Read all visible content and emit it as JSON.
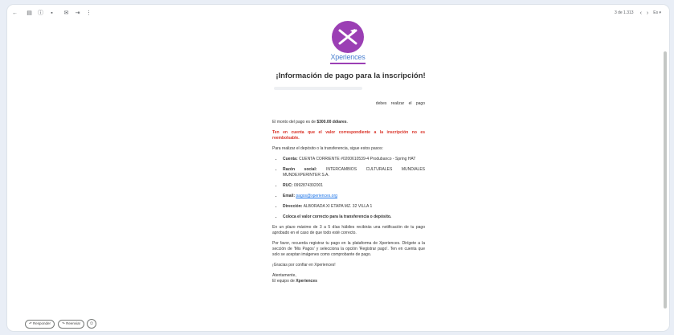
{
  "toolbar": {
    "icons": [
      "back-arrow-icon",
      "archive-icon",
      "report-spam-icon",
      "delete-icon",
      "mark-unread-icon",
      "move-to-icon",
      "more-icon"
    ],
    "count": "3 de 1.313",
    "prev": "‹",
    "next": "›",
    "lang": "Es ▾"
  },
  "logo": {
    "brand": "Xperiences",
    "color": "#9b3fb4"
  },
  "email": {
    "title": "¡Información de pago para la inscripción!",
    "intro_tail": "debes realizar el pago",
    "amount_prefix": "El monto del pago es de ",
    "amount": "$300.00 dólares",
    "amount_suffix": ".",
    "warning": "Ten en cuenta que el valor correspondiente a la inscripción no es reembolsable.",
    "steps_intro": "Para realizar el depósito o la transferencia, sigue estos pasos:",
    "items": [
      {
        "label": "Cuenta:",
        "value": " CUENTA CORRIENTE #0200610539-4 Produbanco - Spring HAT"
      },
      {
        "label": "Razón social:",
        "value": " INTERCAMBIOS CULTURALES MUNDIALES MUNDEXPERINTER S.A."
      },
      {
        "label": "RUC:",
        "value": " 0992874392001"
      },
      {
        "label": "Email:",
        "value": "pagos@xperiences.org"
      },
      {
        "label": "Dirección:",
        "value": " ALBORADA XI ETAPA MZ. 32 VILLA 1"
      },
      {
        "label": "Coloca el valor correcto para la transferencia o depósito.",
        "value": ""
      }
    ],
    "notice": "En un plazo máximo de 3 a 5 días hábiles recibirás una notificación de tu pago aprobado en el caso de que todo esté correcto.",
    "reminder": "Por favor, recuerda registrar tu pago en la plataforma de Xperiences. Dirígete a la sección de 'Mis Pagos' y selecciona la opción 'Registrar pago'. Ten en cuenta que solo se aceptan imágenes como comprobante de pago.",
    "thanks": "¡Gracias por confiar en Xperiences!",
    "closing": "Atentamente,",
    "signature_prefix": "El equipo de ",
    "signature_brand": "Xperiences"
  },
  "reply_bar": {
    "reply": "↶ Responder",
    "forward": "↷ Reenviar",
    "emoji": "☺"
  }
}
